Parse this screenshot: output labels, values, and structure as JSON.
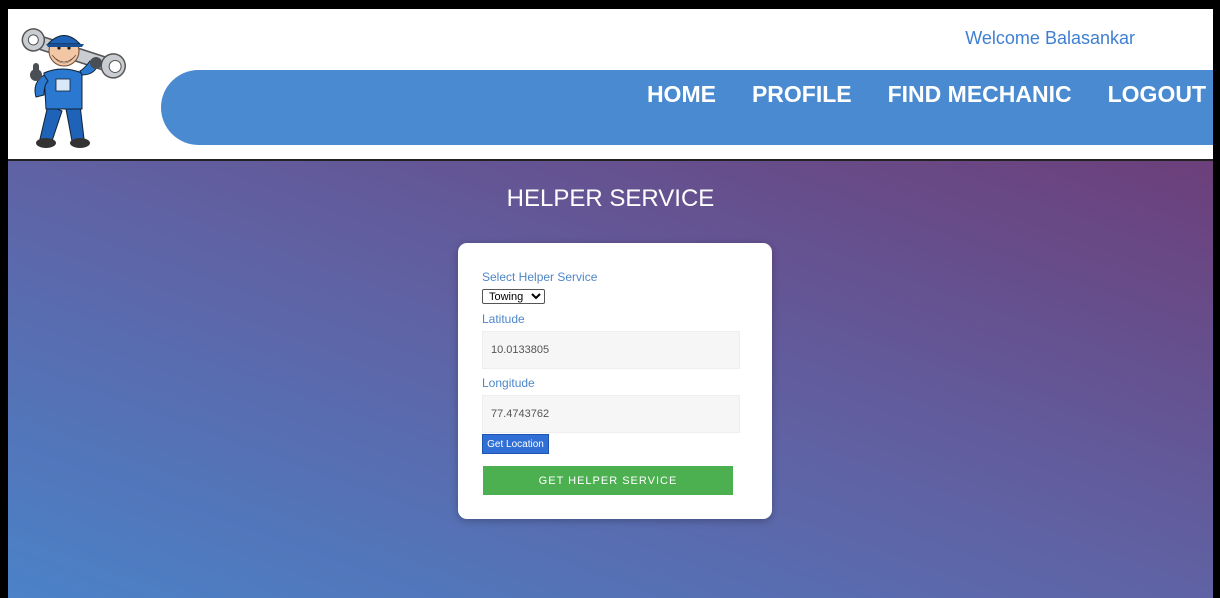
{
  "header": {
    "welcome_text": "Welcome Balasankar",
    "logo_icon": "mechanic-mascot-icon"
  },
  "nav": {
    "items": [
      {
        "label": "HOME"
      },
      {
        "label": "PROFILE"
      },
      {
        "label": "FIND MECHANIC"
      },
      {
        "label": "LOGOUT"
      }
    ]
  },
  "main": {
    "title": "HELPER SERVICE",
    "form": {
      "service_label": "Select Helper Service",
      "service_selected": "Towing",
      "latitude_label": "Latitude",
      "latitude_value": "10.0133805",
      "longitude_label": "Longitude",
      "longitude_value": "77.4743762",
      "get_location_label": "Get Location",
      "submit_label": "GET HELPER SERVICE"
    }
  },
  "colors": {
    "nav_bar": "#4a8ad1",
    "accent_text": "#4e87c9",
    "submit_button": "#4caf50",
    "location_button": "#2f6fd6",
    "gradient_start": "#4b82c8",
    "gradient_end": "#6c3f7a"
  }
}
